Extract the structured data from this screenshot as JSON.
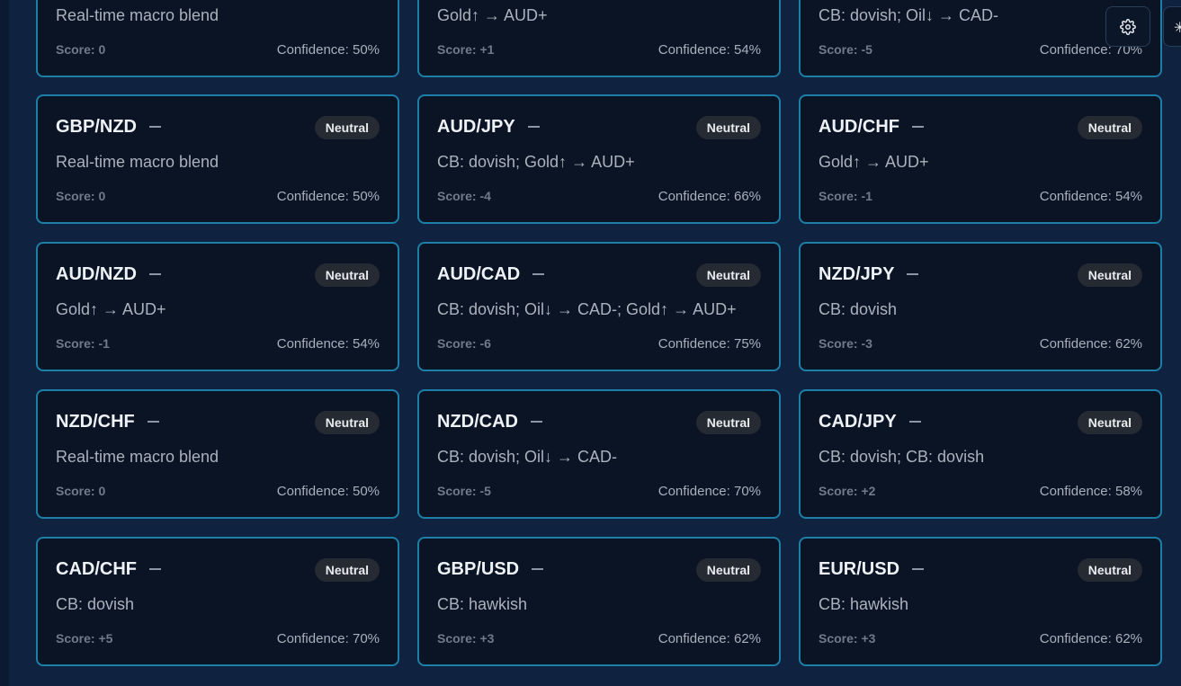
{
  "cards": [
    {
      "pair": "",
      "badge": "",
      "desc": "Real-time macro blend",
      "score": "Score: 0",
      "confidence": "Confidence: 50%"
    },
    {
      "pair": "",
      "badge": "",
      "desc": "Gold↑ → AUD+",
      "score": "Score: +1",
      "confidence": "Confidence: 54%"
    },
    {
      "pair": "",
      "badge": "",
      "desc": "CB: dovish; Oil↓ → CAD-",
      "score": "Score: -5",
      "confidence": "Confidence: 70%"
    },
    {
      "pair": "GBP/NZD",
      "badge": "Neutral",
      "desc": "Real-time macro blend",
      "score": "Score: 0",
      "confidence": "Confidence: 50%"
    },
    {
      "pair": "AUD/JPY",
      "badge": "Neutral",
      "desc": "CB: dovish; Gold↑ → AUD+",
      "score": "Score: -4",
      "confidence": "Confidence: 66%"
    },
    {
      "pair": "AUD/CHF",
      "badge": "Neutral",
      "desc": "Gold↑ → AUD+",
      "score": "Score: -1",
      "confidence": "Confidence: 54%"
    },
    {
      "pair": "AUD/NZD",
      "badge": "Neutral",
      "desc": "Gold↑ → AUD+",
      "score": "Score: -1",
      "confidence": "Confidence: 54%"
    },
    {
      "pair": "AUD/CAD",
      "badge": "Neutral",
      "desc": "CB: dovish; Oil↓ → CAD-; Gold↑ → AUD+",
      "score": "Score: -6",
      "confidence": "Confidence: 75%"
    },
    {
      "pair": "NZD/JPY",
      "badge": "Neutral",
      "desc": "CB: dovish",
      "score": "Score: -3",
      "confidence": "Confidence: 62%"
    },
    {
      "pair": "NZD/CHF",
      "badge": "Neutral",
      "desc": "Real-time macro blend",
      "score": "Score: 0",
      "confidence": "Confidence: 50%"
    },
    {
      "pair": "NZD/CAD",
      "badge": "Neutral",
      "desc": "CB: dovish; Oil↓ → CAD-",
      "score": "Score: -5",
      "confidence": "Confidence: 70%"
    },
    {
      "pair": "CAD/JPY",
      "badge": "Neutral",
      "desc": "CB: dovish; CB: dovish",
      "score": "Score: +2",
      "confidence": "Confidence: 58%"
    },
    {
      "pair": "CAD/CHF",
      "badge": "Neutral",
      "desc": "CB: dovish",
      "score": "Score: +5",
      "confidence": "Confidence: 70%"
    },
    {
      "pair": "GBP/USD",
      "badge": "Neutral",
      "desc": "CB: hawkish",
      "score": "Score: +3",
      "confidence": "Confidence: 62%"
    },
    {
      "pair": "EUR/USD",
      "badge": "Neutral",
      "desc": "CB: hawkish",
      "score": "Score: +3",
      "confidence": "Confidence: 62%"
    }
  ],
  "toolbar": {
    "settings_icon": "gear-icon",
    "edge_icon": "collapse-icon"
  },
  "colors": {
    "card_border": "#1d7fa6",
    "card_bg": "#0b1424",
    "page_bg": "#0f2240"
  }
}
